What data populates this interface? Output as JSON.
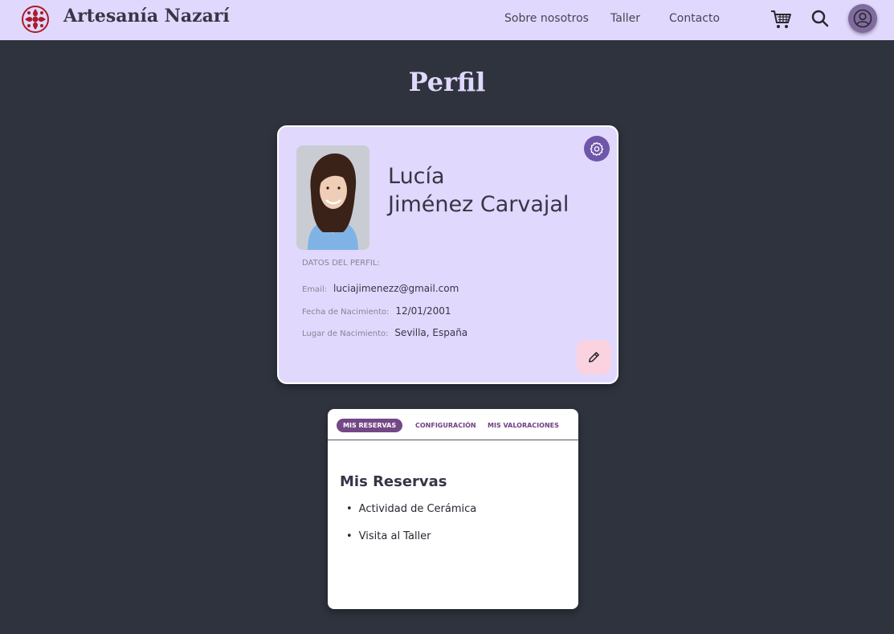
{
  "header": {
    "brand": "Artesanía Nazarí",
    "nav": [
      "Sobre nosotros",
      "Taller",
      "Contacto"
    ],
    "icons": [
      "flower-logo-icon",
      "cart-icon",
      "search-icon",
      "user-icon"
    ]
  },
  "page_title": "Perfil",
  "profile": {
    "first_name": "Lucía",
    "last_name": "Jiménez Carvajal",
    "section_label": "DATOS DEL PERFIL:",
    "fields": [
      {
        "label": "Email:",
        "value": "luciajimenezz@gmail.com"
      },
      {
        "label": "Fecha de Nacimiento:",
        "value": "12/01/2001"
      },
      {
        "label": "Lugar de Nacimiento:",
        "value": "Sevilla, España"
      }
    ]
  },
  "tabs": [
    "MIS RESERVAS",
    "CONFIGURACIÓN",
    "MIS VALORACIONES"
  ],
  "reservations": {
    "heading": "Mis Reservas",
    "items": [
      "Actividad de Cerámica",
      "Visita al Taller"
    ]
  },
  "colors": {
    "background": "#2f333e",
    "header": "#e1d8fd",
    "accent": "#744786",
    "logo": "#a81c2a"
  }
}
